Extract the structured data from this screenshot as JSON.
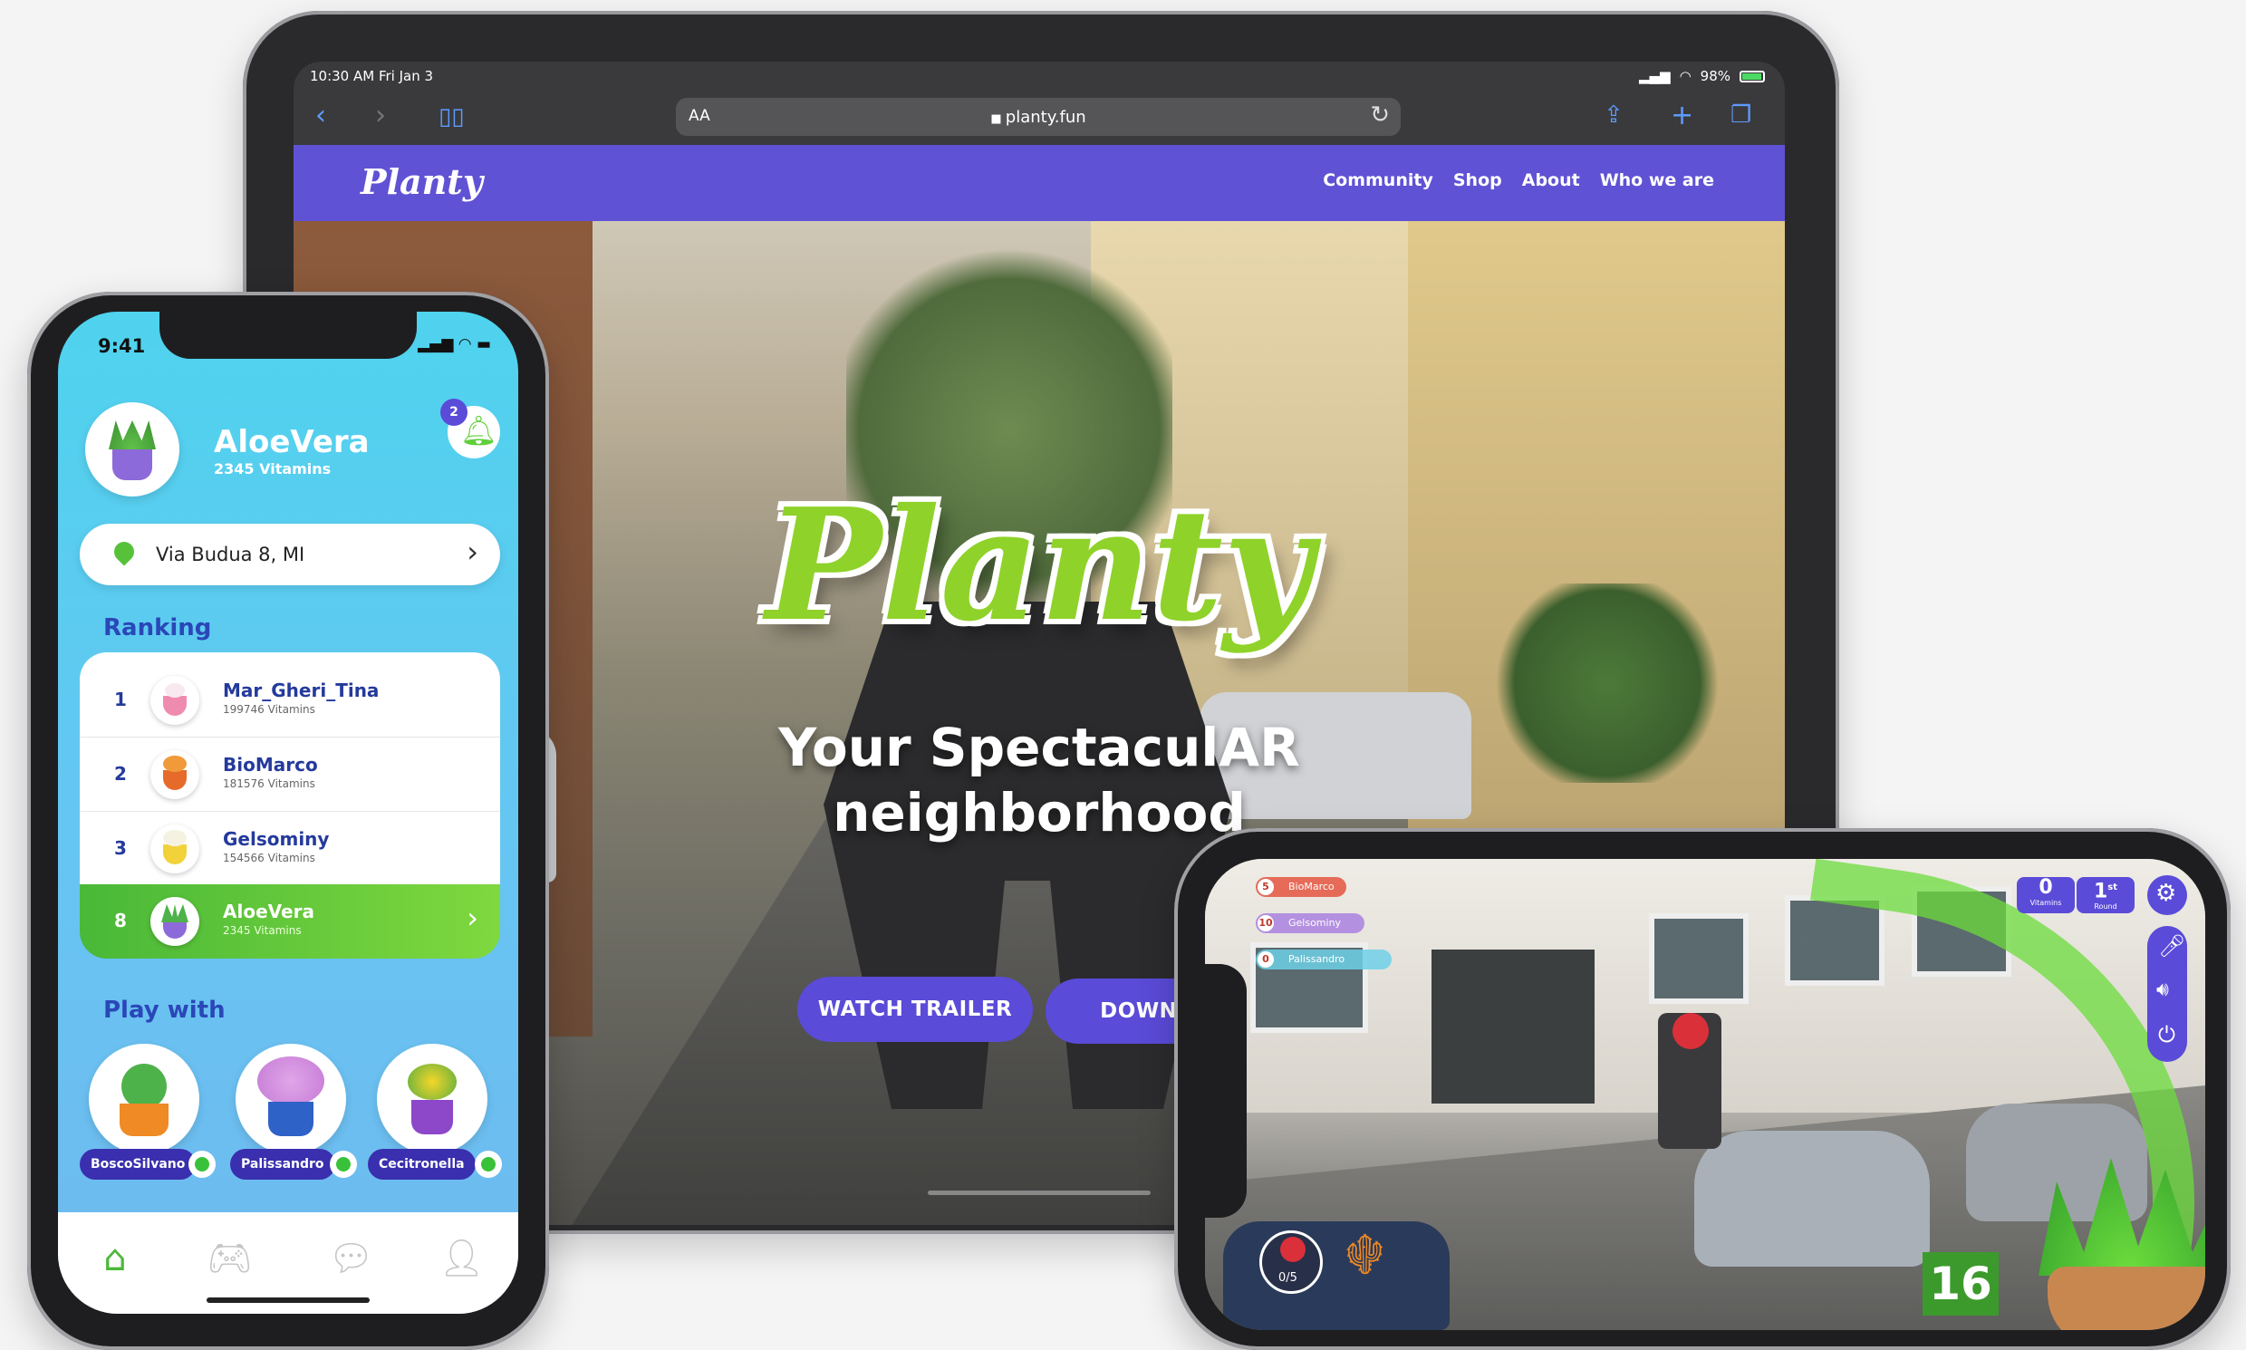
{
  "ipad": {
    "status_time": "10:30 AM   Fri Jan 3",
    "status_right": "98%",
    "url_aa": "AA",
    "url": "planty.fun",
    "site": {
      "logo": "Planty",
      "nav": [
        "Community",
        "Shop",
        "About",
        "Who we are"
      ]
    },
    "hero": {
      "logo": "Planty",
      "tagline_1": "Your SpectaculAR",
      "tagline_2": "neighborhood",
      "watch_trailer": "WATCH TRAILER",
      "download": "DOWNLO"
    }
  },
  "phone_portrait": {
    "time": "9:41",
    "user": {
      "name": "AloeVera",
      "vitamins": "2345 Vitamins"
    },
    "notifications": "2",
    "address": "Via Budua 8, MI",
    "ranking_title": "Ranking",
    "ranking": [
      {
        "rank": "1",
        "name": "Mar_Gheri_Tina",
        "vitamins": "199746 Vitamins",
        "color": "#f08bb0"
      },
      {
        "rank": "2",
        "name": "BioMarco",
        "vitamins": "181576 Vitamins",
        "color": "#e66a2a"
      },
      {
        "rank": "3",
        "name": "Gelsominy",
        "vitamins": "154566 Vitamins",
        "color": "#f2d23a"
      }
    ],
    "me": {
      "rank": "8",
      "name": "AloeVera",
      "vitamins": "2345 Vitamins"
    },
    "play_title": "Play with",
    "play_with": [
      {
        "name": "BoscoSilvano",
        "pot": "#f08a24",
        "leaf": "#4db24a"
      },
      {
        "name": "Palissandro",
        "pot": "#2f62c7",
        "leaf": "#d693e0"
      },
      {
        "name": "Cecitronella",
        "pot": "#8d47c9",
        "leaf": "#f4d62a"
      }
    ],
    "tabs": [
      "home-icon",
      "gamepad-icon",
      "chat-icon",
      "profile-icon"
    ]
  },
  "phone_landscape": {
    "leaderboard": [
      {
        "rank": "5",
        "name": "BioMarco",
        "color": "#e4553f"
      },
      {
        "rank": "10",
        "name": "Gelsominy",
        "color": "#a57be0"
      },
      {
        "rank": "0",
        "name": "Palissandro",
        "color": "#6fd0e6"
      }
    ],
    "vitamins_value": "0",
    "vitamins_label": "Vitamins",
    "round_value": "1",
    "round_sup": "st",
    "round_label": "Round",
    "ammo": "0/5",
    "counter": "16"
  },
  "colors": {
    "brand": "#5a4bd8",
    "green": "#49b838",
    "sky": "#4fd3ee"
  }
}
